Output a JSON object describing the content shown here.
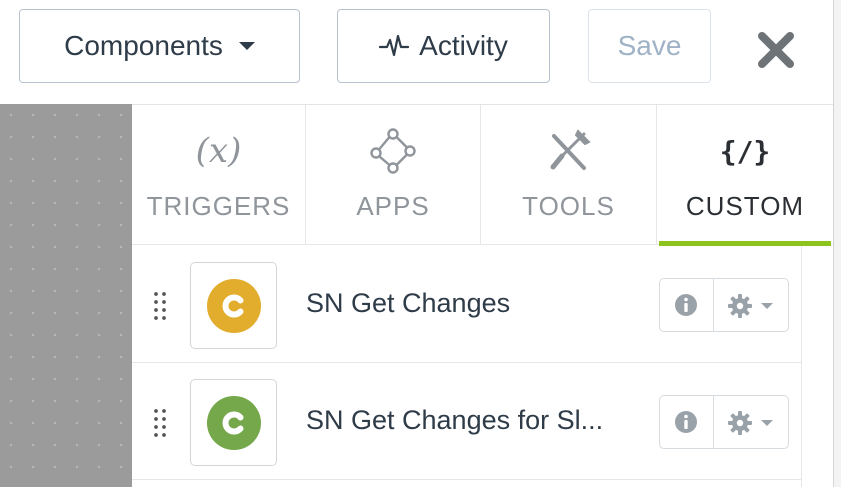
{
  "toolbar": {
    "components_label": "Components",
    "activity_label": "Activity",
    "save_label": "Save"
  },
  "tabs": [
    {
      "label": "TRIGGERS",
      "icon": "function-icon",
      "glyph": "(x)",
      "active": false
    },
    {
      "label": "APPS",
      "icon": "apps-nodes-icon",
      "active": false
    },
    {
      "label": "TOOLS",
      "icon": "tools-icon",
      "active": false
    },
    {
      "label": "CUSTOM",
      "icon": "code-icon",
      "glyph": "{/}",
      "active": true
    }
  ],
  "components": [
    {
      "name": "SN Get Changes",
      "badge_letter": "C",
      "badge_color": "#e2ac2c"
    },
    {
      "name": "SN Get Changes for Sl...",
      "badge_letter": "C",
      "badge_color": "#74a84b"
    }
  ],
  "colors": {
    "active_tab_underline": "#8cc31c",
    "text_dark": "#2e3b48",
    "text_muted": "#8f959b",
    "save_disabled": "#9fb2c6"
  }
}
